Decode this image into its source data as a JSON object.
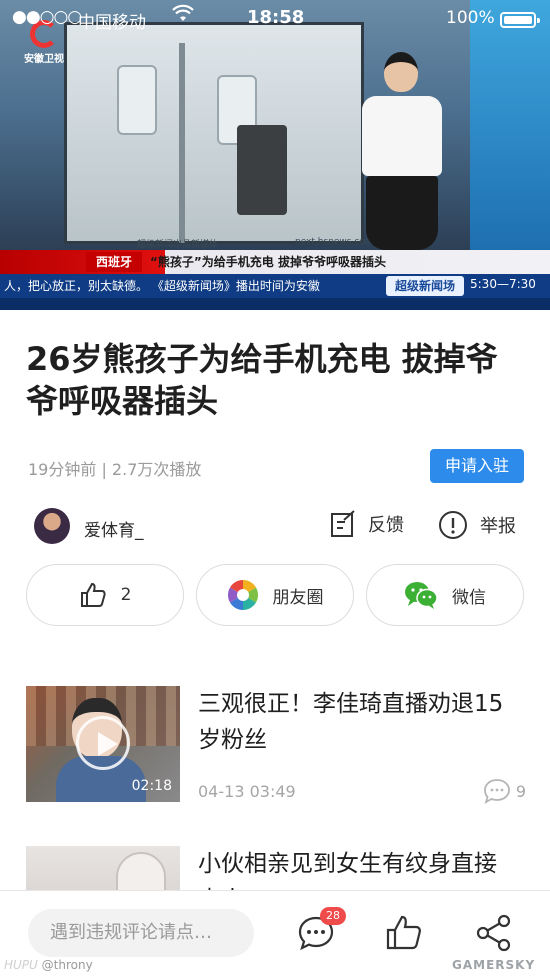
{
  "status_bar": {
    "signal": "●●○○○",
    "carrier": "中国移动",
    "time": "18:58",
    "battery": "100%"
  },
  "video": {
    "channel_logo": "安徽卫视",
    "region_tag": "西班牙",
    "headline": "“熊孩子”为给手机充电  拔掉爷爷呼吸器插头",
    "ticker": "人，把心放正，别太缺德。    《超级新闻场》播出时间为安徽",
    "ticker_logo": "超级新闻场",
    "ticker_time": "5:30—7:30",
    "screen_caption": "超级新闻出品新媒体",
    "screen_url": "next.hsnews.com"
  },
  "article": {
    "title": "26岁熊孩子为给手机充电 拔掉爷爷呼吸器插头",
    "meta": "19分钟前 | 2.7万次播放",
    "apply_button": "申请入驻",
    "author": "爱体育_",
    "feedback": "反馈",
    "report": "举报"
  },
  "actions": {
    "like_count": "2",
    "moments": "朋友圈",
    "wechat": "微信"
  },
  "related": [
    {
      "title": "三观很正！李佳琦直播劝退15岁粉丝",
      "time": "04-13 03:49",
      "comments": "9",
      "duration": "02:18"
    },
    {
      "title": "小伙相亲见到女生有纹身直接走人"
    }
  ],
  "bottom_bar": {
    "comment_placeholder": "遇到违规评论请点…",
    "comment_badge": "28"
  },
  "watermarks": {
    "left_brand": "HUPU",
    "left_user": "@throny",
    "right": "GAMERSKY"
  }
}
